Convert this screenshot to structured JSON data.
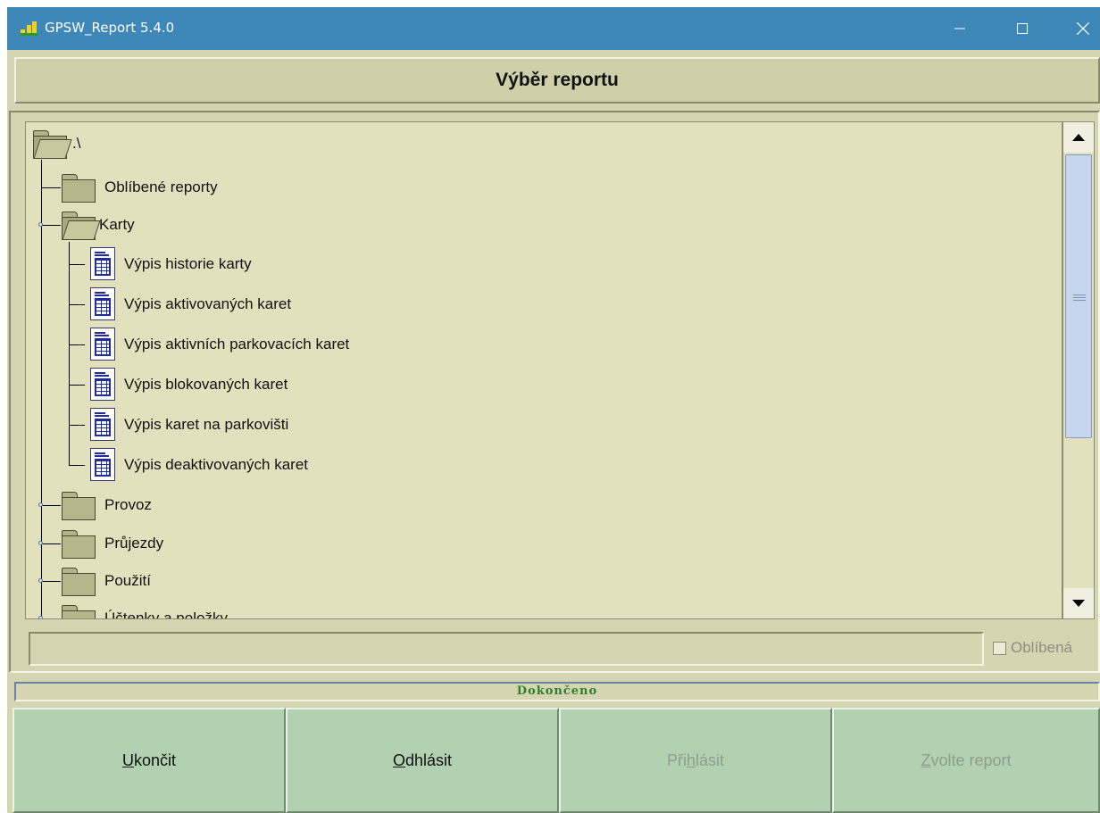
{
  "window": {
    "title": "GPSW_Report 5.4.0",
    "controls": {
      "minimize": "minimize-icon",
      "maximize": "maximize-icon",
      "close": "close-icon"
    }
  },
  "header": {
    "title": "Výběr reportu"
  },
  "tree": {
    "root": {
      "label": ".\\"
    },
    "nodes": [
      {
        "label": "Oblíbené reporty",
        "icon": "folder-icon"
      },
      {
        "label": "Karty",
        "icon": "open-folder-icon"
      },
      {
        "label": "Výpis historie karty",
        "icon": "report-icon"
      },
      {
        "label": "Výpis aktivovaných karet",
        "icon": "report-icon"
      },
      {
        "label": "Výpis aktivních parkovacích karet",
        "icon": "report-icon"
      },
      {
        "label": "Výpis blokovaných karet",
        "icon": "report-icon"
      },
      {
        "label": "Výpis karet na parkovišti",
        "icon": "report-icon"
      },
      {
        "label": "Výpis deaktivovaných karet",
        "icon": "report-icon"
      },
      {
        "label": "Provoz",
        "icon": "folder-icon"
      },
      {
        "label": "Průjezdy",
        "icon": "folder-icon"
      },
      {
        "label": "Použití",
        "icon": "folder-icon"
      },
      {
        "label": "Účtenky a položky",
        "icon": "folder-icon"
      }
    ]
  },
  "path_field": {
    "value": ""
  },
  "favorite": {
    "label": "Oblíbená",
    "checked": false
  },
  "status": {
    "text": "Dokončeno"
  },
  "buttons": {
    "exit": {
      "pre": "",
      "key": "U",
      "post": "končit"
    },
    "logout": {
      "pre": "",
      "key": "O",
      "post": "dhlásit"
    },
    "login": {
      "pre": "Při",
      "key": "h",
      "post": "lásit"
    },
    "choose": {
      "pre": "",
      "key": "Z",
      "post": "volte report"
    }
  },
  "colors": {
    "titlebar": "#3d87b9",
    "panel": "#d6d5b2",
    "tree_bg": "#e3e1bd",
    "button_bg": "#b1d1b1",
    "status_text": "#2f7f2f"
  }
}
